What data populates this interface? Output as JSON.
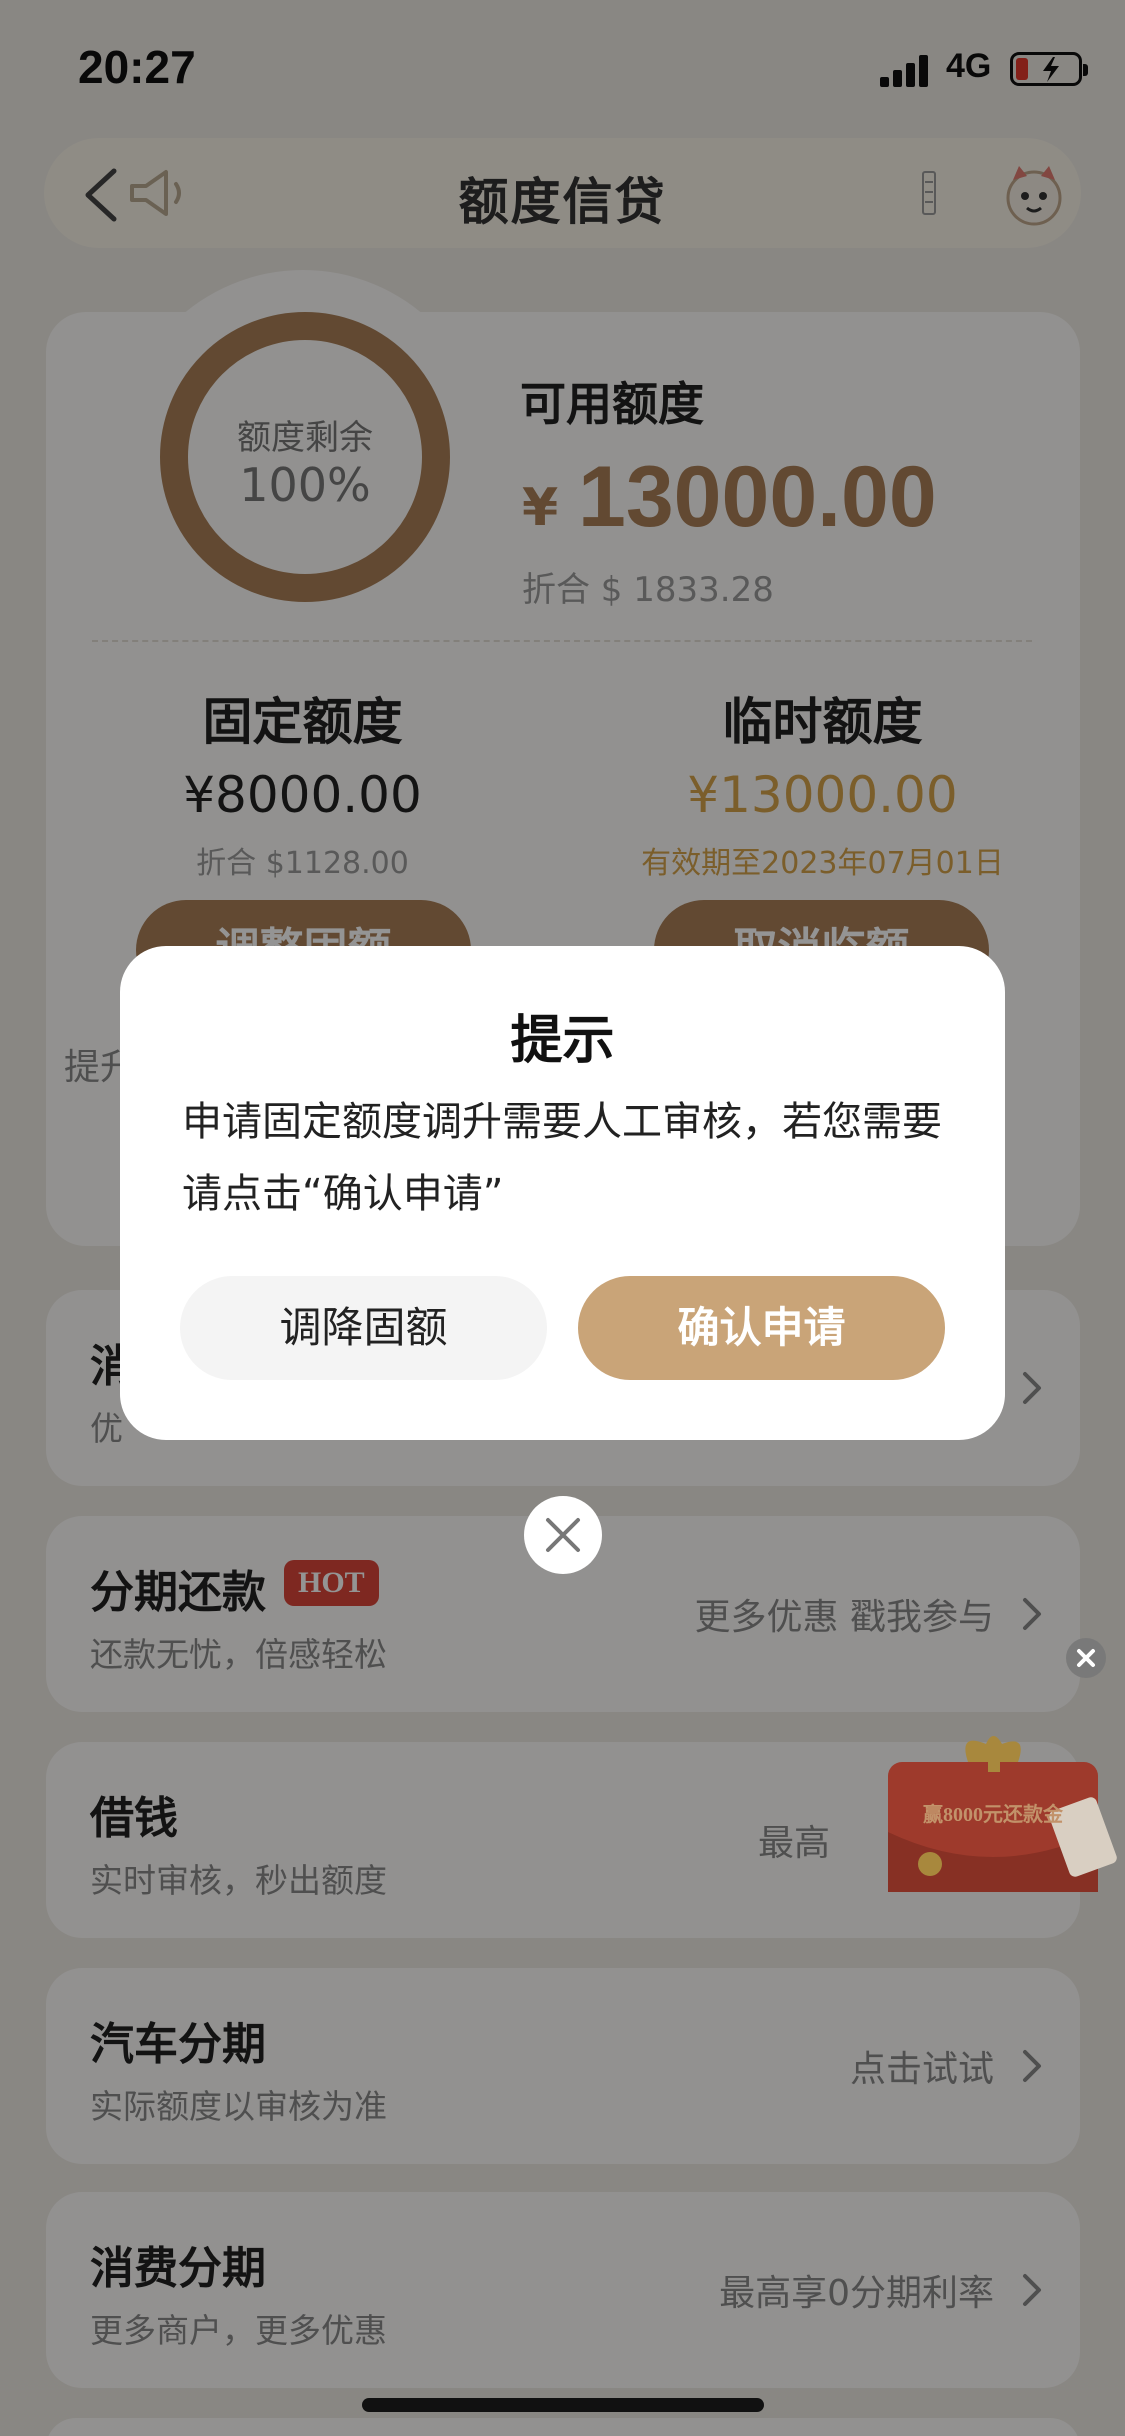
{
  "status_bar": {
    "time": "20:27",
    "network": "4G"
  },
  "nav": {
    "title": "额度信贷"
  },
  "credit": {
    "ring_label": "额度剩余",
    "ring_value": "100%",
    "available_label": "可用额度",
    "currency_symbol": "¥",
    "available_amount": "13000.00",
    "available_usd": "折合 $ 1833.28",
    "fixed_title": "固定额度",
    "fixed_amount": "¥8000.00",
    "fixed_usd": "折合 $1128.00",
    "temp_title": "临时额度",
    "temp_amount": "¥13000.00",
    "temp_expire": "有效期至2023年07月01日",
    "adjust_button": "调整固额",
    "cancel_temp_button": "取消临额",
    "promo_text": "提升"
  },
  "list": [
    {
      "title": "消",
      "subtitle": "优",
      "right": ""
    },
    {
      "title": "分期还款",
      "badge": "HOT",
      "subtitle": "还款无忧，倍感轻松",
      "right": "更多优惠 戳我参与"
    },
    {
      "title": "借钱",
      "subtitle": "实时审核，秒出额度",
      "right": "最高"
    },
    {
      "title": "汽车分期",
      "subtitle": "实际额度以审核为准",
      "right": "点击试试"
    },
    {
      "title": "消费分期",
      "subtitle": "更多商户，更多优惠",
      "right": "最高享0分期利率"
    }
  ],
  "promo_envelope": {
    "text": "赢8000元还款金"
  },
  "modal": {
    "title": "提示",
    "body": "申请固定额度调升需要人工审核，若您需要请点击“确认申请”",
    "decrease_button": "调降固额",
    "confirm_button": "确认申请"
  },
  "colors": {
    "accent": "#a97f57",
    "gold": "#d4a24b",
    "confirm": "#c9a478",
    "hot": "#d9463a"
  }
}
